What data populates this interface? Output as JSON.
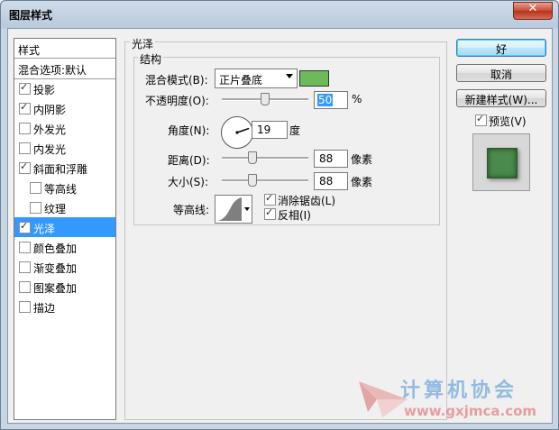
{
  "window": {
    "title": "图层样式"
  },
  "styles_list": {
    "header": "样式",
    "blend_options": "混合选项:默认",
    "items": [
      {
        "label": "投影",
        "checked": true,
        "indent": false,
        "selected": false
      },
      {
        "label": "内阴影",
        "checked": true,
        "indent": false,
        "selected": false
      },
      {
        "label": "外发光",
        "checked": false,
        "indent": false,
        "selected": false
      },
      {
        "label": "内发光",
        "checked": false,
        "indent": false,
        "selected": false
      },
      {
        "label": "斜面和浮雕",
        "checked": true,
        "indent": false,
        "selected": false
      },
      {
        "label": "等高线",
        "checked": false,
        "indent": true,
        "selected": false
      },
      {
        "label": "纹理",
        "checked": false,
        "indent": true,
        "selected": false
      },
      {
        "label": "光泽",
        "checked": true,
        "indent": false,
        "selected": true
      },
      {
        "label": "颜色叠加",
        "checked": false,
        "indent": false,
        "selected": false
      },
      {
        "label": "渐变叠加",
        "checked": false,
        "indent": false,
        "selected": false
      },
      {
        "label": "图案叠加",
        "checked": false,
        "indent": false,
        "selected": false
      },
      {
        "label": "描边",
        "checked": false,
        "indent": false,
        "selected": false
      }
    ]
  },
  "panel": {
    "title": "光泽",
    "structure_title": "结构",
    "blend_mode_label": "混合模式(B):",
    "blend_mode_value": "正片叠底",
    "blend_color": "#6dba5b",
    "opacity_label": "不透明度(O):",
    "opacity_value": "50",
    "opacity_unit": "%",
    "opacity_level": 50,
    "angle_label": "角度(N):",
    "angle_value": "19",
    "angle_unit": "度",
    "distance_label": "距离(D):",
    "distance_value": "88",
    "distance_unit": "像素",
    "distance_level": 35,
    "size_label": "大小(S):",
    "size_value": "88",
    "size_unit": "像素",
    "size_level": 35,
    "contour_label": "等高线:",
    "antialias_label": "消除锯齿(L)",
    "antialias_checked": true,
    "invert_label": "反相(I)",
    "invert_checked": true
  },
  "buttons": {
    "ok": "好",
    "cancel": "取消",
    "new_style": "新建样式(W)...",
    "preview_label": "预览(V)",
    "preview_checked": true
  },
  "watermark": {
    "text": "计算机协会",
    "url": "www.gxjmca.com"
  }
}
